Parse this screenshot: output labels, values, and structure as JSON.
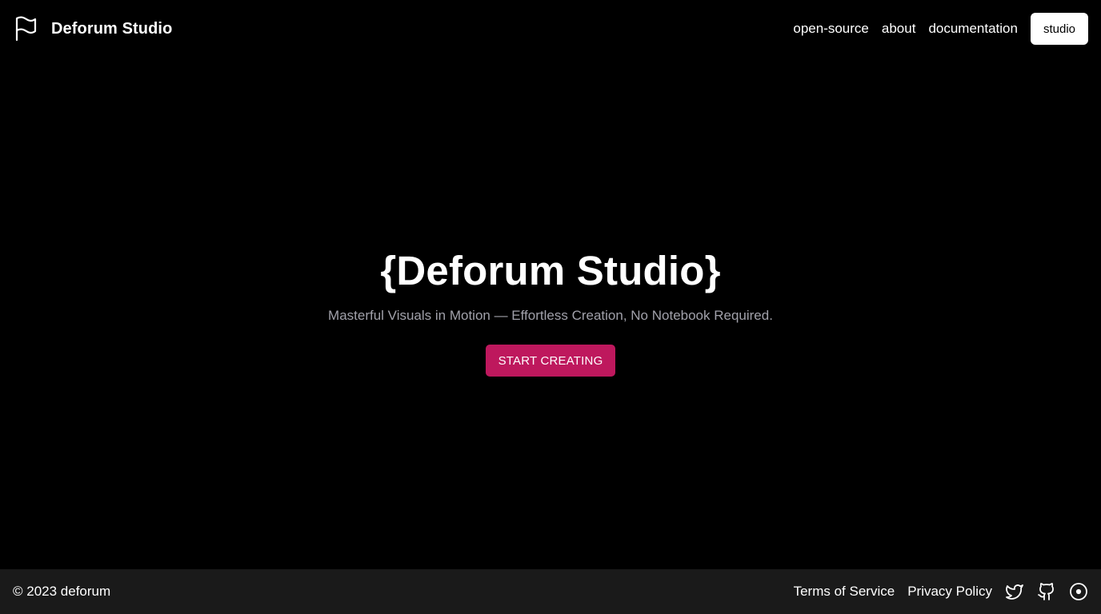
{
  "header": {
    "brand_name": "Deforum Studio",
    "logo_icon": "flag-icon",
    "nav": [
      {
        "label": "open-source"
      },
      {
        "label": "about"
      },
      {
        "label": "documentation"
      }
    ],
    "studio_button": "studio"
  },
  "hero": {
    "title": "{Deforum Studio}",
    "subtitle": "Masterful Visuals in Motion — Effortless Creation, No Notebook Required.",
    "cta_label": "START CREATING"
  },
  "footer": {
    "copyright": "© 2023 deforum",
    "links": [
      {
        "label": "Terms of Service"
      },
      {
        "label": "Privacy Policy"
      }
    ],
    "social_icons": [
      "twitter-icon",
      "github-icon",
      "disc-icon"
    ]
  },
  "colors": {
    "background": "#000000",
    "footer_background": "#1a1a1a",
    "accent": "#be185d",
    "subtitle_text": "#a1a1aa"
  }
}
